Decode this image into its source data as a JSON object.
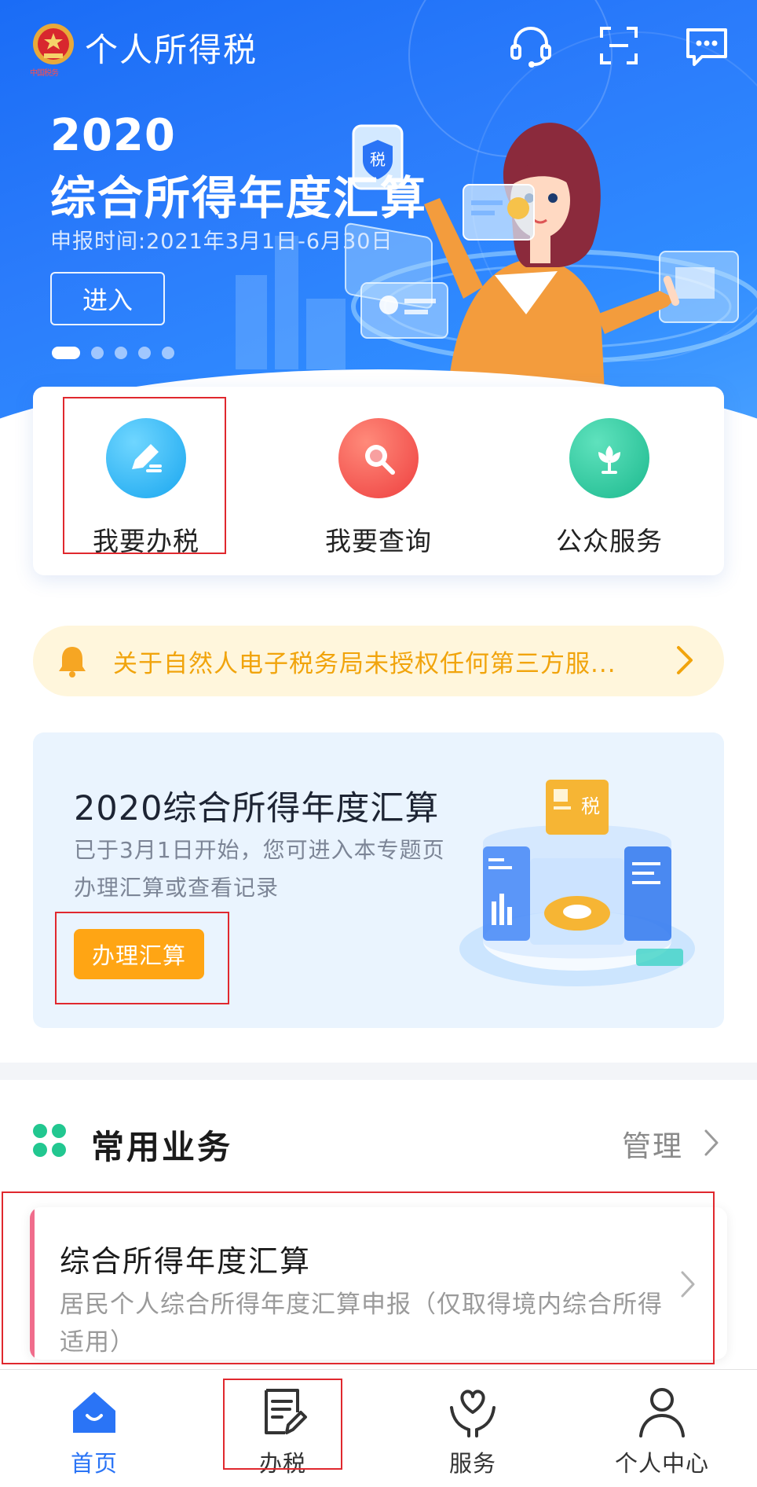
{
  "header": {
    "app_title": "个人所得税",
    "emblem_caption": "中国税务",
    "icons": [
      "headset-icon",
      "scan-icon",
      "message-icon"
    ]
  },
  "banner": {
    "year": "2020",
    "title": "综合所得年度汇算",
    "subtitle": "申报时间:2021年3月1日-6月30日",
    "enter_label": "进入",
    "badge_text": "税",
    "page_count": 5,
    "active_page": 1
  },
  "quick_actions": [
    {
      "label": "我要办税",
      "icon": "pencil-icon",
      "color": "#29b6f6"
    },
    {
      "label": "我要查询",
      "icon": "search-icon",
      "color": "#f2564d"
    },
    {
      "label": "公众服务",
      "icon": "flower-icon",
      "color": "#26c6a0"
    }
  ],
  "notice": {
    "text": "关于自然人电子税务局未授权任何第三方服...",
    "icon": "bell-icon",
    "color": "#f1a40c"
  },
  "promo": {
    "title": "2020综合所得年度汇算",
    "description": "已于3月1日开始，您可进入本专题页办理汇算或查看记录",
    "button_label": "办理汇算",
    "badge_text": "税",
    "button_color": "#ffa514"
  },
  "common_business": {
    "title": "常用业务",
    "manage_label": "管理",
    "items": [
      {
        "title": "综合所得年度汇算",
        "description": "居民个人综合所得年度汇算申报（仅取得境内综合所得适用）"
      }
    ]
  },
  "tabbar": {
    "tabs": [
      {
        "label": "首页",
        "icon": "home-icon",
        "active": true
      },
      {
        "label": "办税",
        "icon": "document-icon",
        "active": false
      },
      {
        "label": "服务",
        "icon": "heart-hand-icon",
        "active": false
      },
      {
        "label": "个人中心",
        "icon": "person-icon",
        "active": false
      }
    ],
    "active_color": "#2a74f6"
  }
}
